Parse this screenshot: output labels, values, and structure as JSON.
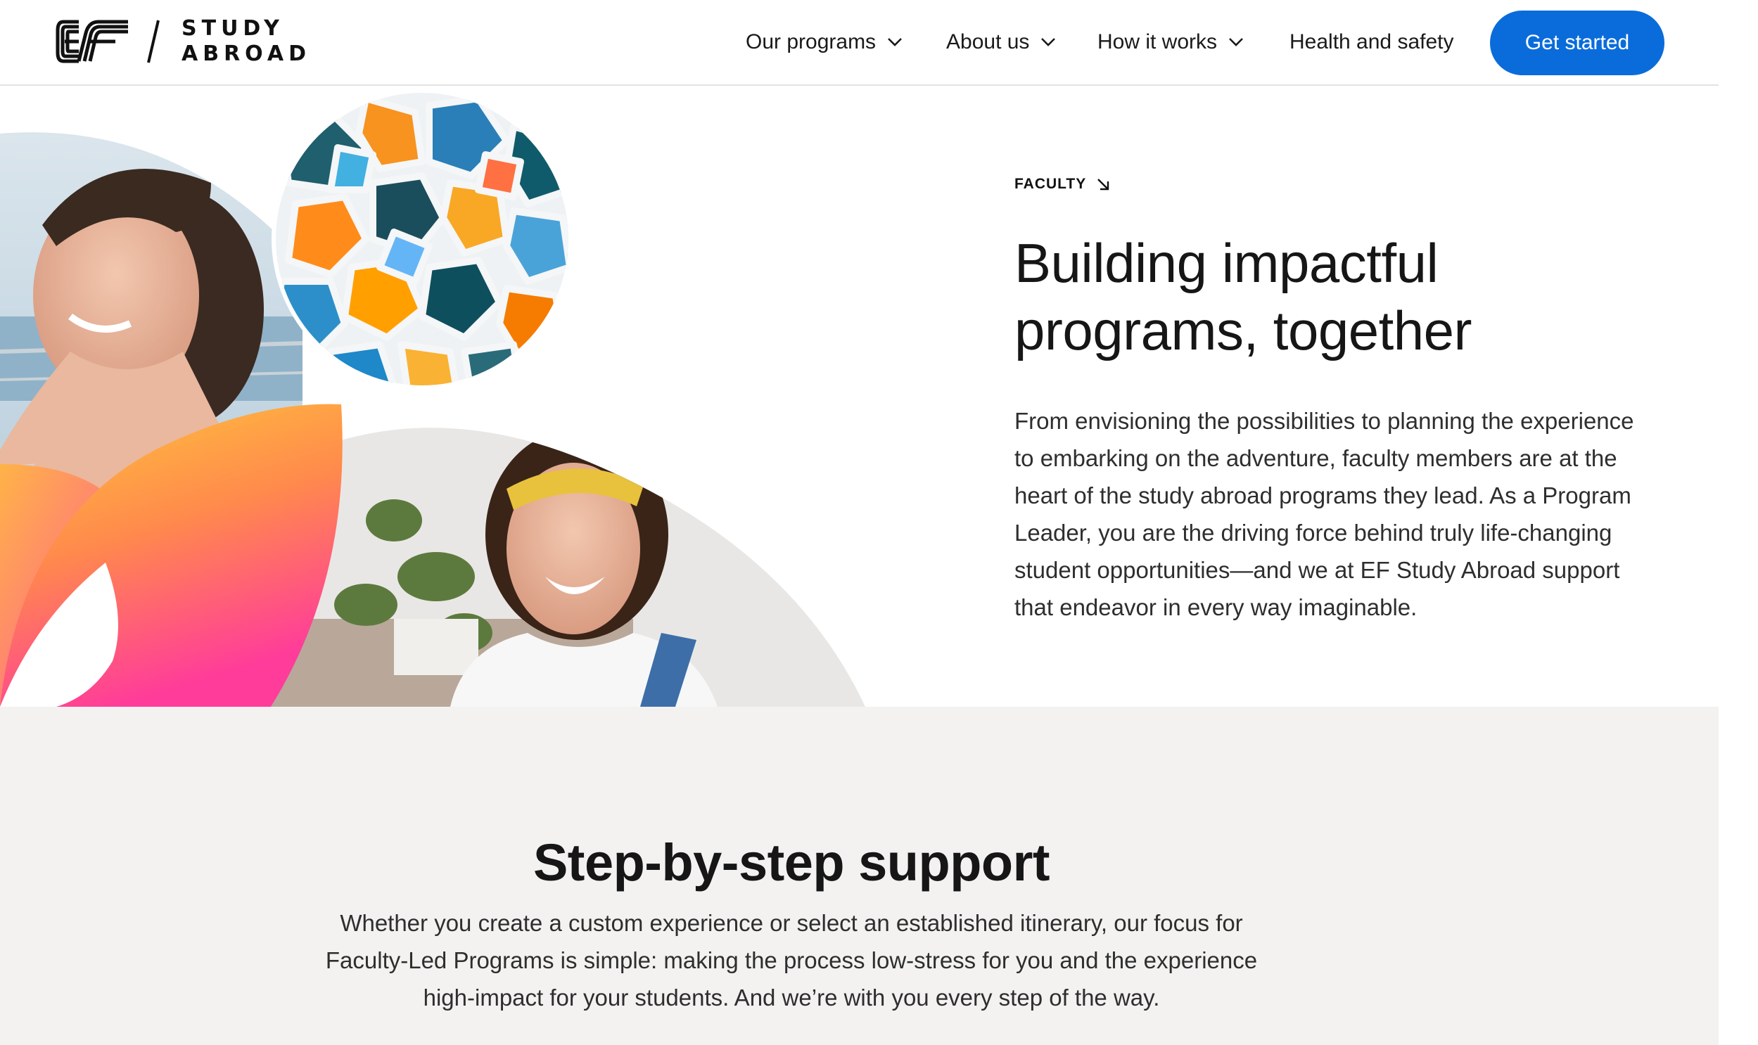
{
  "header": {
    "logo_top": "STUDY",
    "logo_bottom": "ABROAD",
    "nav": [
      {
        "label": "Our programs",
        "has_dropdown": true
      },
      {
        "label": "About us",
        "has_dropdown": true
      },
      {
        "label": "How it works",
        "has_dropdown": true
      },
      {
        "label": "Health and safety",
        "has_dropdown": false
      }
    ],
    "cta_label": "Get started"
  },
  "hero": {
    "eyebrow": "FACULTY",
    "title_line1": "Building impactful",
    "title_line2": "programs, together",
    "body": "From envisioning the possibilities to planning the experience to embarking on the adventure, faculty members are at the heart of the study abroad programs they lead. As a Program Leader, you are the driving force behind truly life-changing student opportunities—and we at EF Study Abroad support that endeavor in every way imaginable."
  },
  "support": {
    "title": "Step-by-step support",
    "body": "Whether you create a custom experience or select an established itinerary, our focus for Faculty-Led Programs is simple: making the process low-stress for you and the experience high-impact for your students. And we’re with you every step of the way."
  },
  "colors": {
    "cta_blue": "#0a6cdb",
    "section_bg": "#f3f2f1",
    "gradient_start": "#ffc93c",
    "gradient_mid": "#ff8a4c",
    "gradient_end": "#ff3c9a"
  },
  "icons": {
    "eyebrow": "arrow-down-right-icon",
    "nav_dropdown": "chevron-down-icon"
  }
}
